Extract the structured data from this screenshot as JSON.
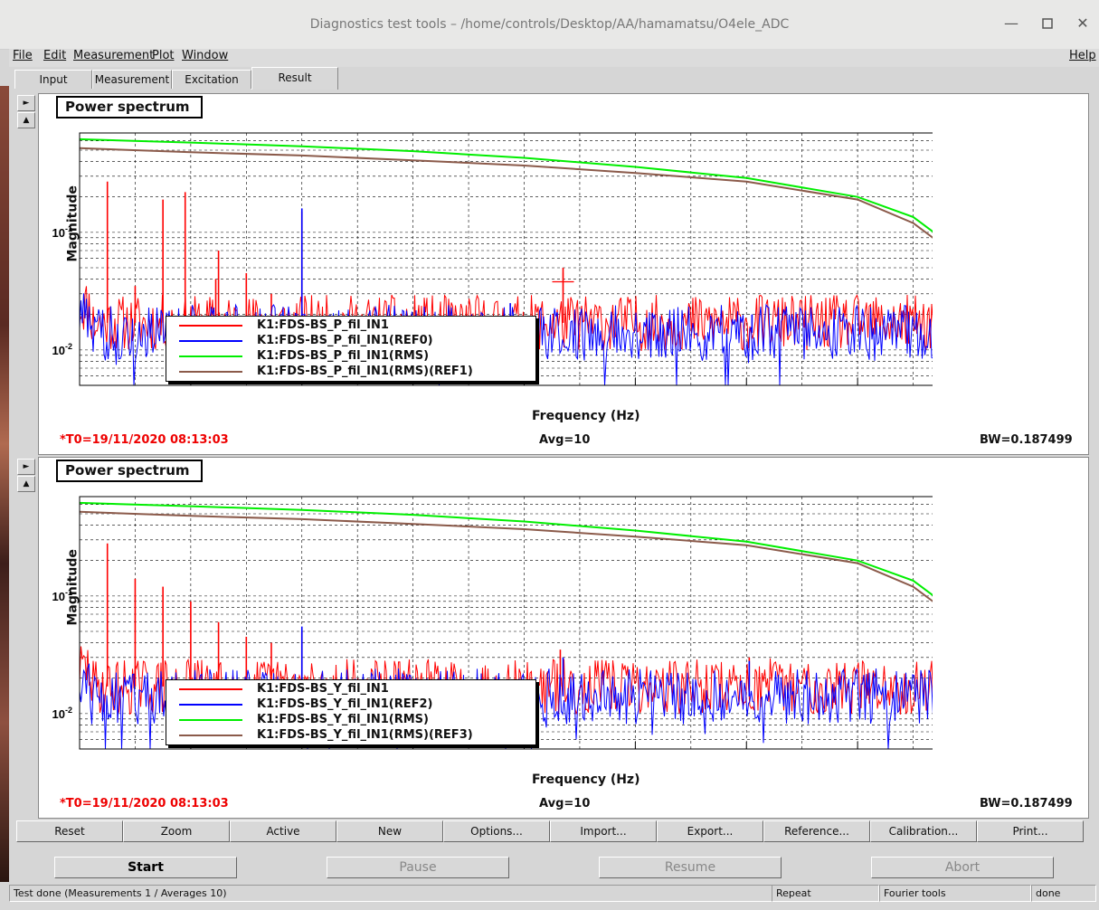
{
  "window": {
    "title": "Diagnostics test tools – /home/controls/Desktop/AA/hamamatsu/O4ele_ADC",
    "min_glyph": "—",
    "max_glyph": "▫",
    "close_glyph": "✕"
  },
  "menu": {
    "file": "File",
    "edit": "Edit",
    "measurement": "Measurement",
    "plot": "Plot",
    "window": "Window",
    "help": "Help"
  },
  "tabs": [
    "Input",
    "Measurement",
    "Excitation",
    "Result"
  ],
  "active_tab": "Result",
  "side_buttons": {
    "right": "►",
    "up": "▲"
  },
  "plots": [
    {
      "title": "Power spectrum",
      "ylabel": "Magnitude",
      "xlabel": "Frequency (Hz)",
      "t0": "*T0=19/11/2020 08:13:03",
      "avg": "Avg=10",
      "bw": "BW=0.187499",
      "legend": [
        "K1:FDS-BS_P_fil_IN1",
        "K1:FDS-BS_P_fil_IN1(REF0)",
        "K1:FDS-BS_P_fil_IN1(RMS)",
        "K1:FDS-BS_P_fil_IN1(RMS)(REF1)"
      ]
    },
    {
      "title": "Power spectrum",
      "ylabel": "Magnitude",
      "xlabel": "Frequency (Hz)",
      "t0": "*T0=19/11/2020 08:13:03",
      "avg": "Avg=10",
      "bw": "BW=0.187499",
      "legend": [
        "K1:FDS-BS_Y_fil_IN1",
        "K1:FDS-BS_Y_fil_IN1(REF2)",
        "K1:FDS-BS_Y_fil_IN1(RMS)",
        "K1:FDS-BS_Y_fil_IN1(RMS)(REF3)"
      ]
    }
  ],
  "chart_data": [
    {
      "type": "line",
      "title": "Power spectrum",
      "xlabel": "Frequency (Hz)",
      "ylabel": "Magnitude",
      "xlim": [
        0,
        1600
      ],
      "ylim": [
        0.005,
        0.7
      ],
      "yscale": "log",
      "xticks": [
        "200",
        "400",
        "600",
        "800",
        "1000",
        "1200",
        "1400",
        "1600"
      ],
      "yticks": [
        "10^-1",
        "10^-2"
      ],
      "grid": true,
      "legend_position": "bottom-left",
      "series": [
        {
          "name": "K1:FDS-BS_P_fil_IN1",
          "color": "#ff0000",
          "kind": "noise",
          "base": 0.017,
          "peaks": [
            [
              50,
              0.27
            ],
            [
              100,
              0.035
            ],
            [
              150,
              0.19
            ],
            [
              190,
              0.22
            ],
            [
              245,
              0.04
            ],
            [
              250,
              0.07
            ],
            [
              300,
              0.045
            ],
            [
              345,
              0.03
            ],
            [
              400,
              0.15
            ],
            [
              870,
              0.05
            ]
          ]
        },
        {
          "name": "K1:FDS-BS_P_fil_IN1(REF0)",
          "color": "#0000ff",
          "kind": "noise",
          "base": 0.014,
          "peaks": [
            [
              400,
              0.16
            ],
            [
              775,
              0.025
            ],
            [
              1210,
              0.02
            ],
            [
              1565,
              0.024
            ]
          ]
        },
        {
          "name": "K1:FDS-BS_P_fil_IN1(RMS)",
          "color": "#00ee00",
          "kind": "rms",
          "start": 0.62,
          "x": [
            0,
            200,
            400,
            600,
            800,
            1000,
            1200,
            1400,
            1500,
            1550,
            1580,
            1600
          ],
          "y": [
            0.62,
            0.58,
            0.54,
            0.49,
            0.43,
            0.36,
            0.29,
            0.2,
            0.135,
            0.09,
            0.05,
            0.008
          ]
        },
        {
          "name": "K1:FDS-BS_P_fil_IN1(RMS)(REF1)",
          "color": "#8b5a4a",
          "kind": "rms",
          "x": [
            0,
            200,
            400,
            600,
            800,
            1000,
            1200,
            1400,
            1500,
            1550,
            1580,
            1600
          ],
          "y": [
            0.52,
            0.48,
            0.45,
            0.41,
            0.37,
            0.32,
            0.27,
            0.19,
            0.12,
            0.08,
            0.045,
            0.02
          ]
        }
      ]
    },
    {
      "type": "line",
      "title": "Power spectrum",
      "xlabel": "Frequency (Hz)",
      "ylabel": "Magnitude",
      "xlim": [
        0,
        1600
      ],
      "ylim": [
        0.005,
        0.7
      ],
      "yscale": "log",
      "xticks": [
        "200",
        "400",
        "600",
        "800",
        "1000",
        "1200",
        "1400",
        "1600"
      ],
      "yticks": [
        "10^-1",
        "10^-2"
      ],
      "grid": true,
      "legend_position": "bottom-left",
      "series": [
        {
          "name": "K1:FDS-BS_Y_fil_IN1",
          "color": "#ff0000",
          "kind": "noise",
          "base": 0.017,
          "peaks": [
            [
              50,
              0.28
            ],
            [
              100,
              0.14
            ],
            [
              150,
              0.12
            ],
            [
              200,
              0.09
            ],
            [
              250,
              0.06
            ],
            [
              300,
              0.045
            ],
            [
              345,
              0.04
            ],
            [
              400,
              0.05
            ],
            [
              865,
              0.035
            ],
            [
              1205,
              0.03
            ]
          ]
        },
        {
          "name": "K1:FDS-BS_Y_fil_IN1(REF2)",
          "color": "#0000ff",
          "kind": "noise",
          "base": 0.014,
          "peaks": [
            [
              400,
              0.055
            ],
            [
              870,
              0.03
            ],
            [
              1205,
              0.028
            ]
          ]
        },
        {
          "name": "K1:FDS-BS_Y_fil_IN1(RMS)",
          "color": "#00ee00",
          "kind": "rms",
          "x": [
            0,
            200,
            400,
            600,
            800,
            1000,
            1200,
            1400,
            1500,
            1550,
            1580,
            1600
          ],
          "y": [
            0.62,
            0.58,
            0.54,
            0.49,
            0.43,
            0.36,
            0.29,
            0.2,
            0.135,
            0.09,
            0.05,
            0.006
          ]
        },
        {
          "name": "K1:FDS-BS_Y_fil_IN1(RMS)(REF3)",
          "color": "#8b5a4a",
          "kind": "rms",
          "x": [
            0,
            200,
            400,
            600,
            800,
            1000,
            1200,
            1400,
            1500,
            1550,
            1580,
            1600
          ],
          "y": [
            0.52,
            0.48,
            0.45,
            0.41,
            0.37,
            0.32,
            0.27,
            0.19,
            0.12,
            0.08,
            0.045,
            0.008
          ]
        }
      ]
    }
  ],
  "buttons": [
    "Reset",
    "Zoom",
    "Active",
    "New",
    "Options...",
    "Import...",
    "Export...",
    "Reference...",
    "Calibration...",
    "Print..."
  ],
  "controls": {
    "start": "Start",
    "pause": "Pause",
    "resume": "Resume",
    "abort": "Abort"
  },
  "status": {
    "message": "Test done (Measurements 1 / Averages 10)",
    "mode": "Repeat",
    "tool": "Fourier tools",
    "state": "done"
  }
}
